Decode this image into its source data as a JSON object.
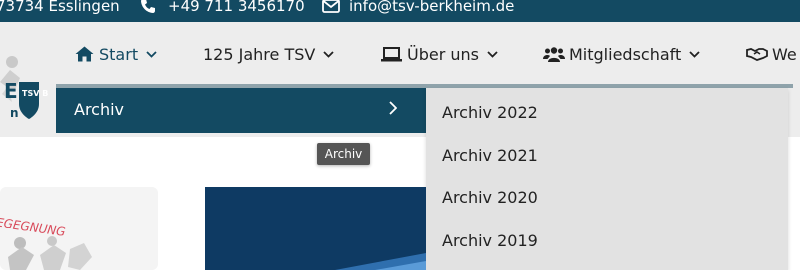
{
  "topbar": {
    "address": "73734 Esslingen",
    "phone": "+49 711 3456170",
    "email": "info@tsv-berkheim.de",
    "icons": [
      "phone-icon",
      "envelope-icon"
    ]
  },
  "logo": {
    "text_main": "E",
    "text_sub": "n",
    "badge": "TSV B"
  },
  "nav": {
    "items": [
      {
        "label": "Start",
        "icon": "home-icon"
      },
      {
        "label": "125 Jahre TSV"
      },
      {
        "label": "Über uns",
        "icon": "laptop-icon"
      },
      {
        "label": "Mitgliedschaft",
        "icon": "users-icon"
      },
      {
        "label": "We",
        "icon": "handshake-icon"
      }
    ]
  },
  "dropdown": {
    "active_item": "Archiv",
    "tooltip": "Archiv",
    "submenu": [
      "Archiv 2022",
      "Archiv 2021",
      "Archiv 2020",
      "Archiv 2019"
    ]
  },
  "content": {
    "card_caption": "EGEGNUNG"
  },
  "colors": {
    "primary": "#134a62",
    "header_bg": "#ededed",
    "submenu_bg": "#e2e2e2",
    "hero_bg": "#0e3a63"
  }
}
